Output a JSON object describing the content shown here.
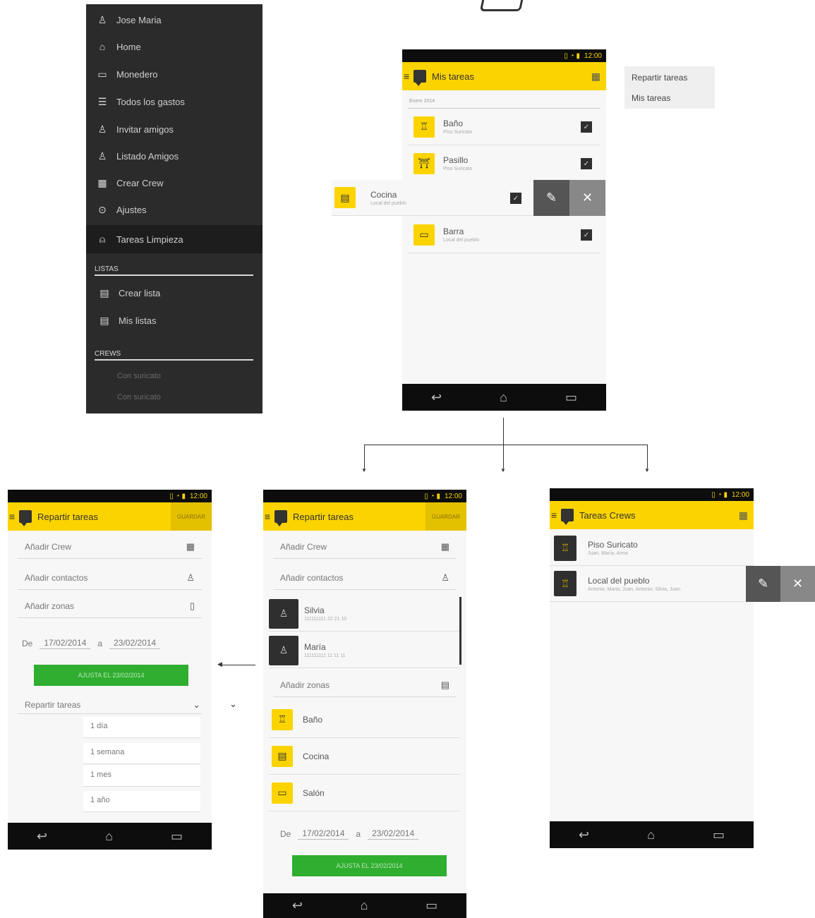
{
  "drawer": {
    "items": [
      {
        "label": "Jose Maria",
        "icon": "user-icon"
      },
      {
        "label": "Home",
        "icon": "home-icon"
      },
      {
        "label": "Monedero",
        "icon": "wallet-icon"
      },
      {
        "label": "Todos los gastos",
        "icon": "list-icon"
      },
      {
        "label": "Invitar amigos",
        "icon": "add-user-icon"
      },
      {
        "label": "Listado Amigos",
        "icon": "friends-icon"
      },
      {
        "label": "Crear Crew",
        "icon": "building-icon"
      },
      {
        "label": "Ajustes",
        "icon": "settings-icon"
      },
      {
        "label": "Tareas Limpieza",
        "icon": "cleaning-icon"
      }
    ],
    "section_lists": "LISTAS",
    "list_items": [
      {
        "label": "Crear lista",
        "icon": "document-icon"
      },
      {
        "label": "Mis listas",
        "icon": "document-icon"
      }
    ],
    "section_crews": "CREWS",
    "crew_items": [
      "Con suricato",
      "Con suricato"
    ]
  },
  "status": {
    "time": "12:00"
  },
  "mis_tareas": {
    "title": "Mis tareas",
    "date_header": "Enero 2014",
    "rows": [
      {
        "title": "Baño",
        "subtitle": "Piso Suricato"
      },
      {
        "title": "Pasillo",
        "subtitle": "Piso Suricato"
      },
      {
        "title": "Cocina",
        "subtitle": "Local del pueblo"
      },
      {
        "title": "Barra",
        "subtitle": "Local del pueblo"
      }
    ]
  },
  "menu_popup": {
    "items": [
      "Repartir tareas",
      "Mis tareas"
    ]
  },
  "repartir_left": {
    "title": "Repartir tareas",
    "save": "GUARDAR",
    "fields": [
      "Añadir Crew",
      "Añadir contactos",
      "Añadir zonas"
    ],
    "date_from_label": "De",
    "date_from": "17/02/2014",
    "date_to_label": "a",
    "date_to": "23/02/2014",
    "green_button": "AJUSTA EL 23/02/2014",
    "dropdown": "Repartir tareas",
    "options": [
      "1 día",
      "1 semana",
      "1 mes",
      "1 año"
    ]
  },
  "repartir_mid": {
    "title": "Repartir tareas",
    "save": "GUARDAR",
    "fields": [
      "Añadir Crew",
      "Añadir contactos"
    ],
    "contacts": [
      {
        "name": "Silvia",
        "phone": "111111111 22 21 10"
      },
      {
        "name": "María",
        "phone": "111111111 11 11 11"
      }
    ],
    "zones_field": "Añadir zonas",
    "zones": [
      "Baño",
      "Cocina",
      "Salón"
    ],
    "date_from_label": "De",
    "date_from": "17/02/2014",
    "date_to_label": "a",
    "date_to": "23/02/2014",
    "green_button": "AJUSTA EL 23/02/2014"
  },
  "tareas_crews": {
    "title": "Tareas Crews",
    "rows": [
      {
        "title": "Piso Suricato",
        "subtitle": "Juan, María, Anna"
      },
      {
        "title": "Local del pueblo",
        "subtitle": "Antonio, Maria, Juan, Antonio, Silvia, Juan"
      }
    ]
  },
  "colors": {
    "accent": "#fbd400",
    "green": "#2fae2f",
    "dark": "#2b2b2b"
  }
}
